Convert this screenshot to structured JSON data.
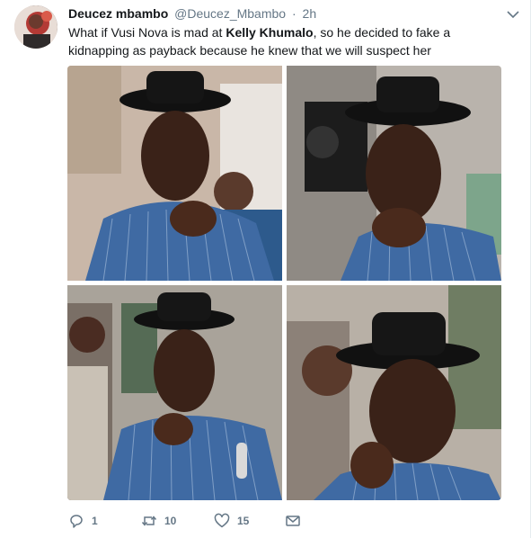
{
  "tweet": {
    "display_name": "Deucez mbambo",
    "handle": "@Deucez_Mbambo",
    "separator": "·",
    "time": "2h",
    "text_part1": "What if Vusi Nova is mad at ",
    "text_bold": "Kelly Khumalo",
    "text_part2": ", so he decided to fake a kidnapping as payback because he knew that we will suspect her"
  },
  "actions": {
    "reply_count": "1",
    "retweet_count": "10",
    "like_count": "15"
  },
  "icons": {
    "reply": "reply-icon",
    "retweet": "retweet-icon",
    "like": "heart-icon",
    "dm": "envelope-icon",
    "caret": "chevron-down-icon"
  },
  "colors": {
    "name": "#14171a",
    "meta": "#657786",
    "border": "#e6ecf0"
  }
}
